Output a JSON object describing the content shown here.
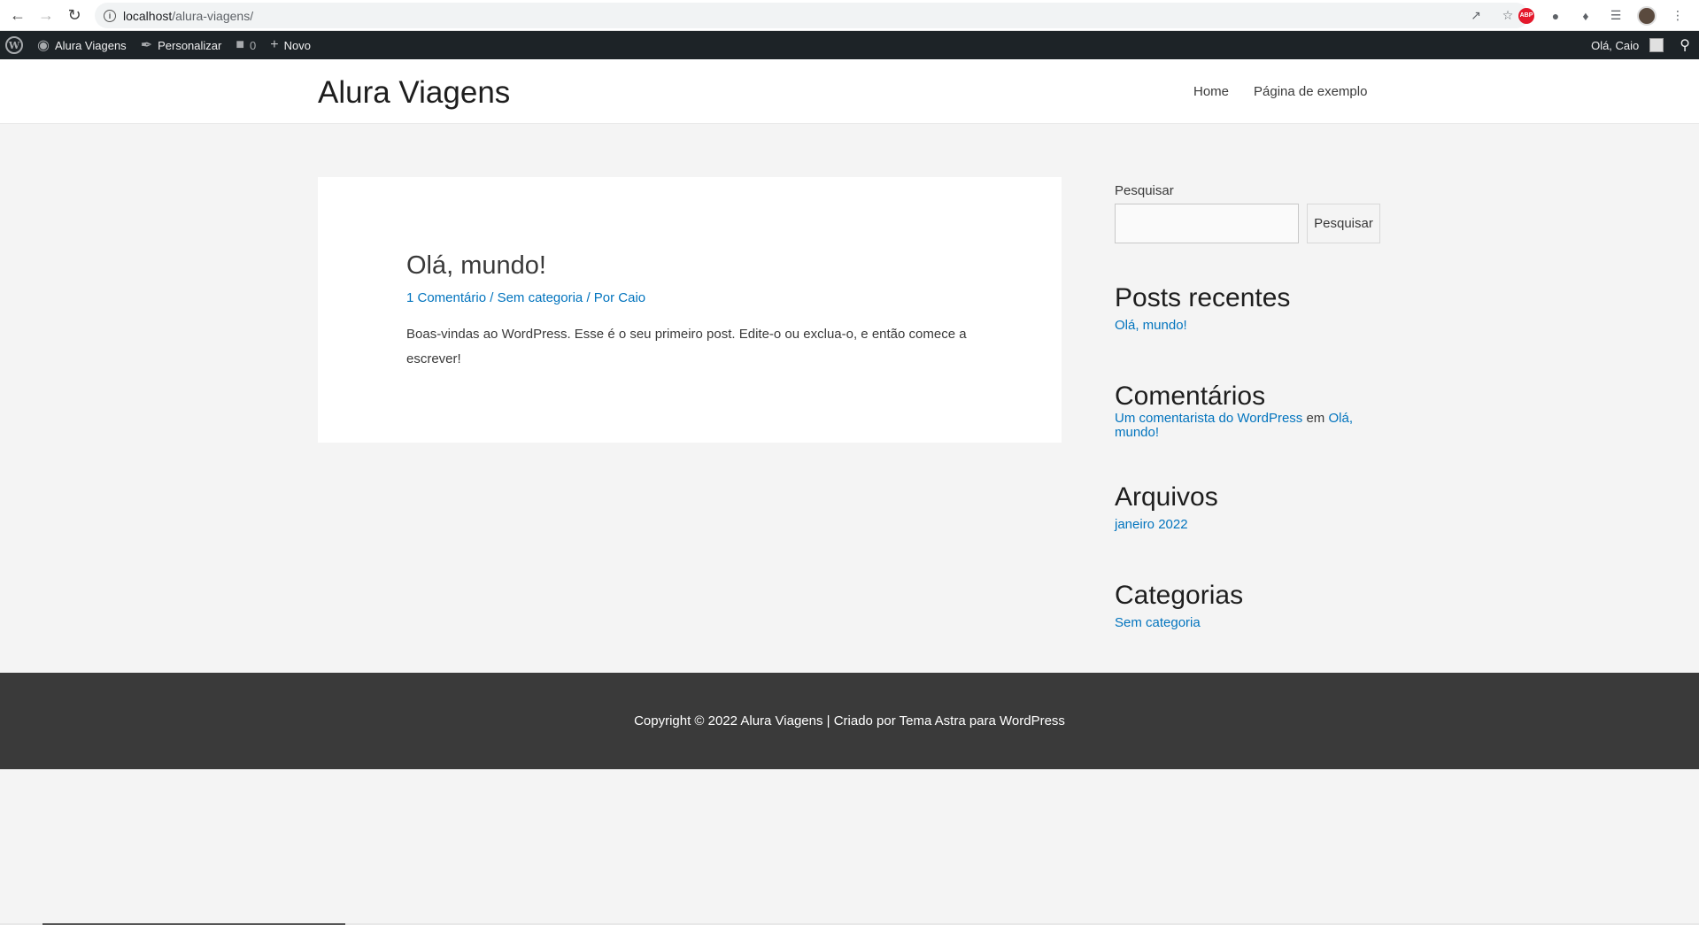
{
  "browser": {
    "url_host": "localhost",
    "url_path": "/alura-viagens/"
  },
  "admin_bar": {
    "site_name": "Alura Viagens",
    "customize": "Personalizar",
    "comments_count": "0",
    "new": "Novo",
    "greeting": "Olá, Caio"
  },
  "header": {
    "site_title": "Alura Viagens",
    "nav": [
      "Home",
      "Página de exemplo"
    ]
  },
  "post": {
    "title": "Olá, mundo!",
    "comments_link": "1 Comentário",
    "sep1": " / ",
    "category": "Sem categoria",
    "sep2": " / Por ",
    "author": "Caio",
    "body": "Boas-vindas ao WordPress. Esse é o seu primeiro post. Edite-o ou exclua-o, e então comece a escrever!"
  },
  "sidebar": {
    "search_label": "Pesquisar",
    "search_button": "Pesquisar",
    "recent_posts_title": "Posts recentes",
    "recent_posts": [
      "Olá, mundo!"
    ],
    "comments_title": "Comentários",
    "comment_author": "Um comentarista do WordPress",
    "comment_on": " em ",
    "comment_post": "Olá, mundo!",
    "archives_title": "Arquivos",
    "archives": [
      "janeiro 2022"
    ],
    "categories_title": "Categorias",
    "categories": [
      "Sem categoria"
    ]
  },
  "footer": {
    "text": "Copyright © 2022 Alura Viagens | Criado por Tema Astra para WordPress"
  },
  "colors": {
    "link": "#0274be",
    "admin_bar_bg": "#1d2327",
    "footer_bg": "#3a3a3a",
    "page_bg": "#f4f4f4"
  }
}
